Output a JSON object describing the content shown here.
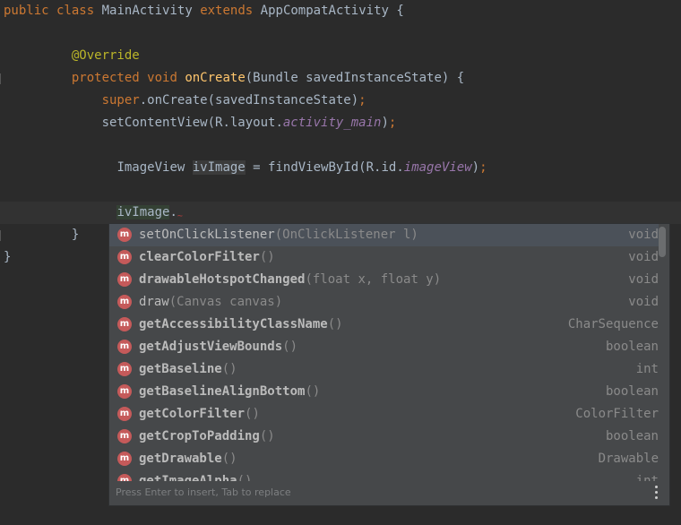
{
  "code": {
    "line1": {
      "kw1": "public",
      "kw2": "class",
      "name": "MainActivity",
      "kw3": "extends",
      "super": "AppCompatActivity {"
    },
    "line3": {
      "annotation": "@Override"
    },
    "line4": {
      "kw1": "protected",
      "kw2": "void",
      "method": "onCreate",
      "rest": "(Bundle savedInstanceState) {"
    },
    "line5": {
      "kw": "super",
      "rest": ".onCreate(savedInstanceState)",
      "semi": ";"
    },
    "line6": {
      "start": "setContentView(R.layout.",
      "field": "activity_main",
      "end": ")",
      "semi": ";"
    },
    "line8": {
      "type": "ImageView ",
      "var": "ivImage",
      "mid": " = findViewById(R.id.",
      "field": "imageView",
      "end": ")",
      "semi": ";"
    },
    "line10": {
      "var": "ivImage",
      "dot": ".",
      "squiggle": "~"
    },
    "line11": {
      "brace": "}"
    },
    "line12": {
      "brace": "}"
    }
  },
  "completion": {
    "badge": "m",
    "items": [
      {
        "name": "setOnClickListener",
        "params": "(OnClickListener l)",
        "type": "void",
        "bold": false
      },
      {
        "name": "clearColorFilter",
        "params": "()",
        "type": "void",
        "bold": true
      },
      {
        "name": "drawableHotspotChanged",
        "params": "(float x, float y)",
        "type": "void",
        "bold": true
      },
      {
        "name": "draw",
        "params": "(Canvas canvas)",
        "type": "void",
        "bold": false
      },
      {
        "name": "getAccessibilityClassName",
        "params": "()",
        "type": "CharSequence",
        "bold": true
      },
      {
        "name": "getAdjustViewBounds",
        "params": "()",
        "type": "boolean",
        "bold": true
      },
      {
        "name": "getBaseline",
        "params": "()",
        "type": "int",
        "bold": true
      },
      {
        "name": "getBaselineAlignBottom",
        "params": "()",
        "type": "boolean",
        "bold": true
      },
      {
        "name": "getColorFilter",
        "params": "()",
        "type": "ColorFilter",
        "bold": true
      },
      {
        "name": "getCropToPadding",
        "params": "()",
        "type": "boolean",
        "bold": true
      },
      {
        "name": "getDrawable",
        "params": "()",
        "type": "Drawable",
        "bold": true
      },
      {
        "name": "getImageAlpha",
        "params": "()",
        "type": "int",
        "bold": true
      }
    ],
    "footer": "Press Enter to insert, Tab to replace",
    "more_icon": "vertical-ellipsis"
  }
}
